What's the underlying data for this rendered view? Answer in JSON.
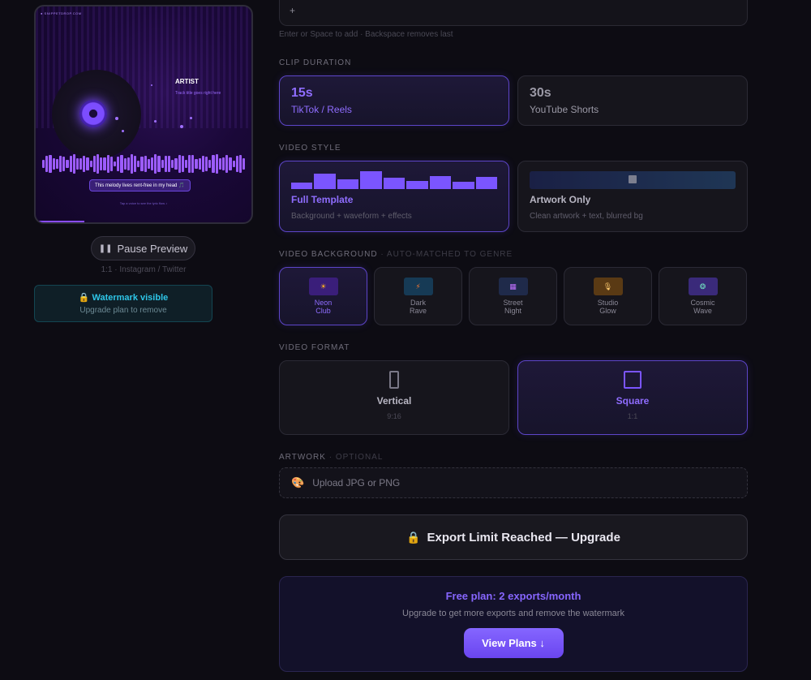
{
  "preview": {
    "brand": "● SNIPPETDROP.COM",
    "artist": "ARTIST",
    "track": "Track title goes right here",
    "lyric": "This melody lives rent-free in my head 🎵",
    "caption": "Tap a voice to see the lyric flow ♪"
  },
  "pause_label": "Pause Preview",
  "format_caption": "1:1 · Instagram / Twitter",
  "watermark": {
    "title": "Watermark visible",
    "sub": "Upgrade plan to remove"
  },
  "tags": {
    "add_symbol": "+",
    "hint": "Enter or Space to add · Backspace removes last"
  },
  "clip_duration": {
    "label": "CLIP DURATION",
    "options": [
      {
        "value": "15s",
        "desc": "TikTok / Reels",
        "selected": true
      },
      {
        "value": "30s",
        "desc": "YouTube Shorts",
        "selected": false
      }
    ]
  },
  "video_style": {
    "label": "VIDEO STYLE",
    "options": [
      {
        "title": "Full Template",
        "sub": "Background + waveform + effects",
        "selected": true
      },
      {
        "title": "Artwork Only",
        "sub": "Clean artwork + text, blurred bg",
        "selected": false
      }
    ],
    "bar_levels": [
      0.35,
      0.85,
      0.55,
      1.0,
      0.65,
      0.45,
      0.75,
      0.4,
      0.7
    ]
  },
  "video_background": {
    "label": "VIDEO BACKGROUND",
    "sublabel": "· AUTO-MATCHED TO GENRE",
    "options": [
      {
        "name": "Neon\nClub",
        "icon": "sun-icon",
        "glyph": "☀",
        "color": "#3a1e7a",
        "glyph_color": "#ffb020",
        "selected": true
      },
      {
        "name": "Dark\nRave",
        "icon": "bolt-icon",
        "glyph": "⚡",
        "color": "#163a55",
        "glyph_color": "#ff7a30",
        "selected": false
      },
      {
        "name": "Street\nNight",
        "icon": "city-icon",
        "glyph": "▦",
        "color": "#1f2a4a",
        "glyph_color": "#c070ff",
        "selected": false
      },
      {
        "name": "Studio\nGlow",
        "icon": "microphone-icon",
        "glyph": "🎙",
        "color": "#5a3a14",
        "glyph_color": "#ffcc70",
        "selected": false
      },
      {
        "name": "Cosmic\nWave",
        "icon": "wave-icon",
        "glyph": "❂",
        "color": "#3a2a7a",
        "glyph_color": "#70e0c0",
        "selected": false
      }
    ]
  },
  "video_format": {
    "label": "VIDEO FORMAT",
    "options": [
      {
        "title": "Vertical",
        "ratio": "9:16",
        "selected": false
      },
      {
        "title": "Square",
        "ratio": "1:1",
        "selected": true
      }
    ]
  },
  "artwork": {
    "label": "ARTWORK",
    "sublabel": "· OPTIONAL",
    "upload_label": "Upload JPG or PNG"
  },
  "export": {
    "label": "Export Limit Reached — Upgrade"
  },
  "upgrade": {
    "title": "Free plan: 2 exports/month",
    "sub": "Upgrade to get more exports and remove the watermark",
    "button": "View Plans ↓"
  }
}
